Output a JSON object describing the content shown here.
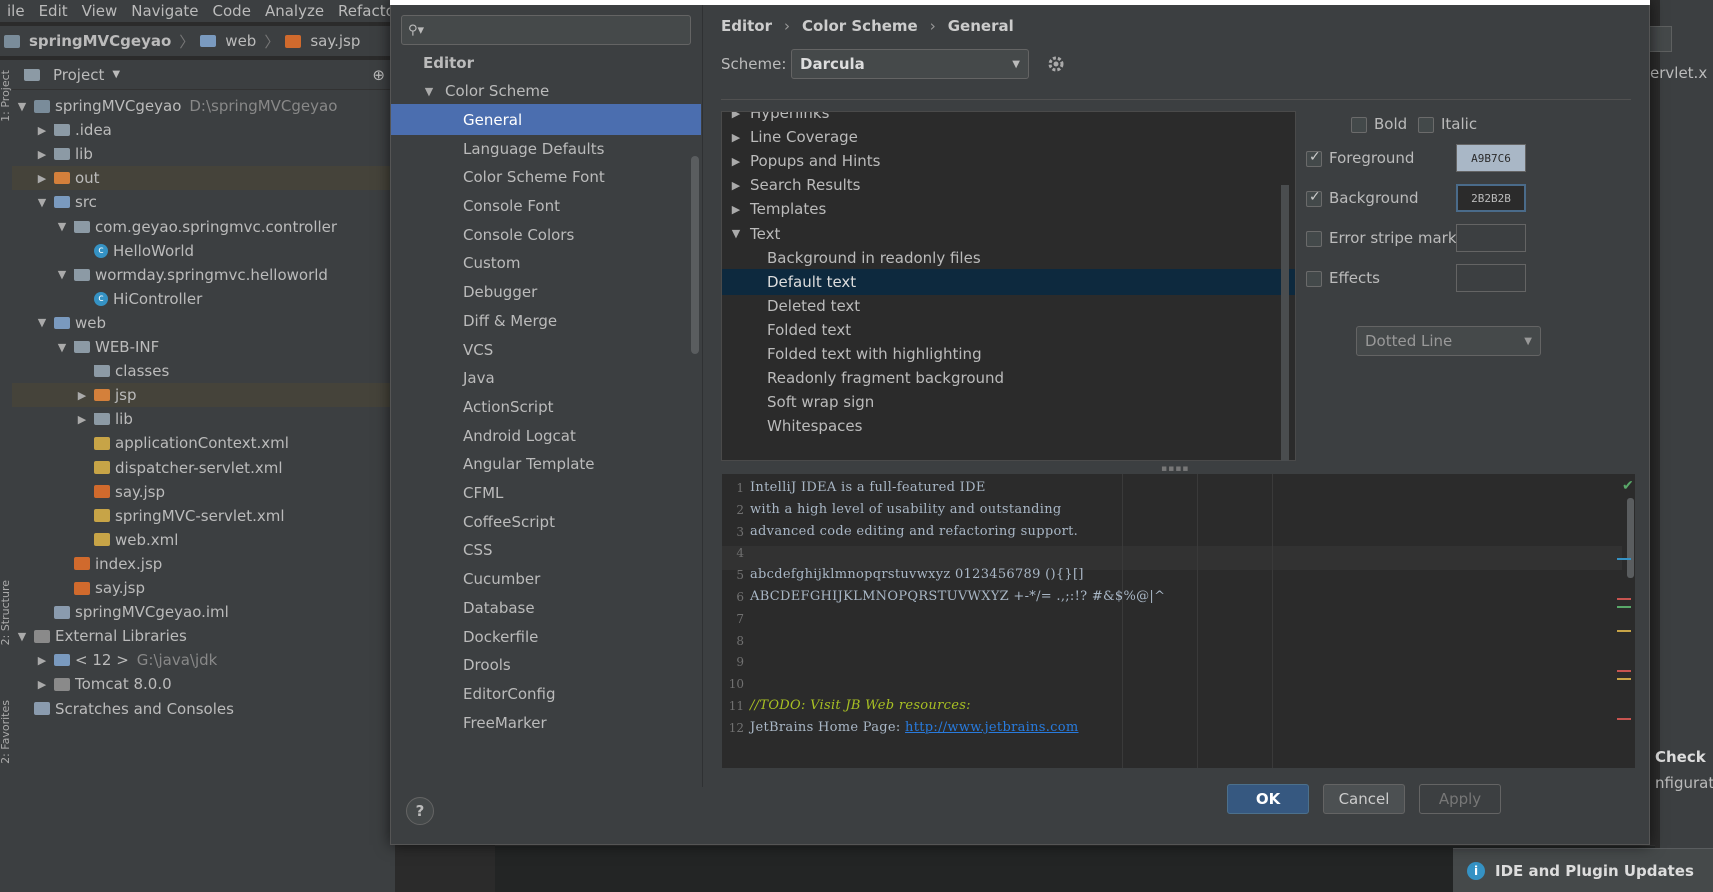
{
  "ide": {
    "menu": [
      "ile",
      "Edit",
      "View",
      "Navigate",
      "Code",
      "Analyze",
      "Refacto"
    ],
    "breadcrumb": [
      "springMVCgeyao",
      "web",
      "say.jsp"
    ],
    "left_tabs": [
      "1: Project",
      "2: Structure",
      "2: Favorites"
    ],
    "project_header": "Project",
    "tree": [
      {
        "label": "springMVCgeyao",
        "extra": "D:\\springMVCgeyao",
        "icon": "module-icon",
        "arrow": "▼"
      },
      {
        "label": ".idea",
        "icon": "folder-icon",
        "arrow": "▶"
      },
      {
        "label": "lib",
        "icon": "folder-icon",
        "arrow": "▶"
      },
      {
        "label": "out",
        "icon": "folder-orange-icon",
        "arrow": "▶"
      },
      {
        "label": "src",
        "icon": "folder-blue-icon",
        "arrow": "▼"
      },
      {
        "label": "com.geyao.springmvc.controller",
        "icon": "package-icon",
        "arrow": "▼"
      },
      {
        "label": "HelloWorld",
        "icon": "class-icon",
        "arrow": ""
      },
      {
        "label": "wormday.springmvc.helloworld",
        "icon": "package-icon",
        "arrow": "▼"
      },
      {
        "label": "HiController",
        "icon": "class-icon",
        "arrow": ""
      },
      {
        "label": "web",
        "icon": "folder-blue-icon",
        "arrow": "▼"
      },
      {
        "label": "WEB-INF",
        "icon": "folder-icon",
        "arrow": "▼"
      },
      {
        "label": "classes",
        "icon": "folder-icon",
        "arrow": ""
      },
      {
        "label": "jsp",
        "icon": "folder-orange-icon",
        "arrow": "▶"
      },
      {
        "label": "lib",
        "icon": "folder-icon",
        "arrow": "▶"
      },
      {
        "label": "applicationContext.xml",
        "icon": "xml-file-icon",
        "arrow": ""
      },
      {
        "label": "dispatcher-servlet.xml",
        "icon": "xml-file-icon",
        "arrow": ""
      },
      {
        "label": "say.jsp",
        "icon": "jsp-file-icon",
        "arrow": ""
      },
      {
        "label": "springMVC-servlet.xml",
        "icon": "xml-file-icon",
        "arrow": ""
      },
      {
        "label": "web.xml",
        "icon": "xml-file-icon",
        "arrow": ""
      },
      {
        "label": "index.jsp",
        "icon": "jsp-file-icon",
        "arrow": ""
      },
      {
        "label": "say.jsp",
        "icon": "jsp-file-icon",
        "arrow": ""
      },
      {
        "label": "springMVCgeyao.iml",
        "icon": "iml-file-icon",
        "arrow": ""
      },
      {
        "label": "External Libraries",
        "icon": "library-icon",
        "arrow": "▼"
      },
      {
        "label": "< 12 >",
        "extra": "G:\\java\\jdk",
        "icon": "jdk-icon",
        "arrow": "▶"
      },
      {
        "label": "Tomcat 8.0.0",
        "icon": "library-icon",
        "arrow": "▶"
      },
      {
        "label": "Scratches and Consoles",
        "icon": "scratches-icon",
        "arrow": ""
      }
    ],
    "right_tab_label": "ervlet.x",
    "right_check": "Check",
    "right_config": "nfiguratio",
    "notification": "IDE and Plugin Updates"
  },
  "dialog": {
    "search": {
      "placeholder": ""
    },
    "nav": [
      {
        "label": "Editor",
        "arrow": "",
        "bold": true
      },
      {
        "label": "Color Scheme",
        "arrow": "▼"
      },
      {
        "label": "General",
        "selected": true
      },
      {
        "label": "Language Defaults"
      },
      {
        "label": "Color Scheme Font"
      },
      {
        "label": "Console Font"
      },
      {
        "label": "Console Colors"
      },
      {
        "label": "Custom"
      },
      {
        "label": "Debugger"
      },
      {
        "label": "Diff & Merge"
      },
      {
        "label": "VCS"
      },
      {
        "label": "Java"
      },
      {
        "label": "ActionScript"
      },
      {
        "label": "Android Logcat"
      },
      {
        "label": "Angular Template"
      },
      {
        "label": "CFML"
      },
      {
        "label": "CoffeeScript"
      },
      {
        "label": "CSS"
      },
      {
        "label": "Cucumber"
      },
      {
        "label": "Database"
      },
      {
        "label": "Dockerfile"
      },
      {
        "label": "Drools"
      },
      {
        "label": "EditorConfig"
      },
      {
        "label": "FreeMarker"
      }
    ],
    "breadcrumb": [
      "Editor",
      "Color Scheme",
      "General"
    ],
    "scheme_label": "Scheme:",
    "scheme_value": "Darcula",
    "attributes": [
      {
        "label": "Hyperlinks",
        "arrow": "▶",
        "level": 0
      },
      {
        "label": "Line Coverage",
        "arrow": "▶",
        "level": 0
      },
      {
        "label": "Popups and Hints",
        "arrow": "▶",
        "level": 0
      },
      {
        "label": "Search Results",
        "arrow": "▶",
        "level": 0
      },
      {
        "label": "Templates",
        "arrow": "▶",
        "level": 0
      },
      {
        "label": "Text",
        "arrow": "▼",
        "level": 0
      },
      {
        "label": "Background in readonly files",
        "level": 1
      },
      {
        "label": "Default text",
        "level": 1,
        "selected": true
      },
      {
        "label": "Deleted text",
        "level": 1
      },
      {
        "label": "Folded text",
        "level": 1
      },
      {
        "label": "Folded text with highlighting",
        "level": 1
      },
      {
        "label": "Readonly fragment background",
        "level": 1
      },
      {
        "label": "Soft wrap sign",
        "level": 1
      },
      {
        "label": "Whitespaces",
        "level": 1
      }
    ],
    "props": {
      "bold": "Bold",
      "italic": "Italic",
      "foreground": "Foreground",
      "foreground_value": "A9B7C6",
      "background": "Background",
      "background_value": "2B2B2B",
      "error_stripe": "Error stripe mark",
      "effects": "Effects",
      "effects_type": "Dotted Line"
    },
    "preview_lines": [
      {
        "n": "1",
        "text": "IntelliJ IDEA is a full-featured IDE"
      },
      {
        "n": "2",
        "text": "with a high level of usability and outstanding"
      },
      {
        "n": "3",
        "text": "advanced code editing and refactoring support."
      },
      {
        "n": "4",
        "text": ""
      },
      {
        "n": "5",
        "text": "abcdefghijklmnopqrstuvwxyz 0123456789 (){}[]"
      },
      {
        "n": "6",
        "text": "ABCDEFGHIJKLMNOPQRSTUVWXYZ +-*/= .,;:!? #&$%@|^"
      },
      {
        "n": "7",
        "text": ""
      },
      {
        "n": "8",
        "text": ""
      },
      {
        "n": "9",
        "text": ""
      },
      {
        "n": "10",
        "text": ""
      },
      {
        "n": "11",
        "text": "//TODO: Visit JB Web resources:"
      },
      {
        "n": "12",
        "text": "JetBrains Home Page: ",
        "link": "http://www.jetbrains.com"
      }
    ],
    "buttons": {
      "ok": "OK",
      "cancel": "Cancel",
      "apply": "Apply",
      "help": "?"
    }
  },
  "colors": {
    "selection": "#4b6eaf",
    "attr_selection": "#0d293e",
    "ok_button": "#365880",
    "foreground_swatch": "#a9b7c6",
    "background_swatch": "#2b2b2b",
    "todo": "#a8c023",
    "link": "#287bde"
  }
}
